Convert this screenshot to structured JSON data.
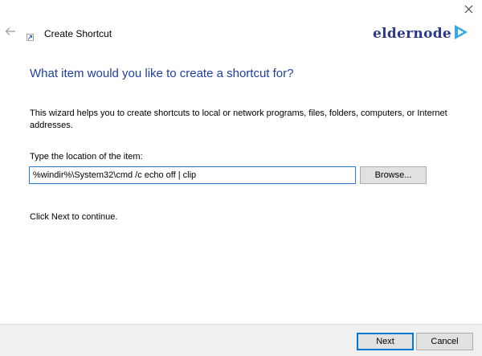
{
  "window": {
    "title": "Create Shortcut",
    "close_glyph": "✕",
    "back_glyph": "←"
  },
  "logo": {
    "text": "eldernode",
    "color": "#2b3a8c",
    "accent": "#38a8e0"
  },
  "wizard": {
    "heading": "What item would you like to create a shortcut for?",
    "intro": "This wizard helps you to create shortcuts to local or network programs, files, folders, computers, or Internet addresses.",
    "location_label": "Type the location of the item:",
    "location_value": "%windir%\\System32\\cmd /c echo off | clip",
    "browse_label": "Browse...",
    "continue_text": "Click Next to continue."
  },
  "footer": {
    "next_label": "Next",
    "cancel_label": "Cancel"
  },
  "colors": {
    "heading": "#1f3f9f",
    "focus_border": "#0078d7",
    "footer_bg": "#f0f0f0"
  },
  "icons": [
    "close-icon",
    "back-arrow-icon",
    "shortcut-app-icon",
    "logo-play-icon"
  ]
}
